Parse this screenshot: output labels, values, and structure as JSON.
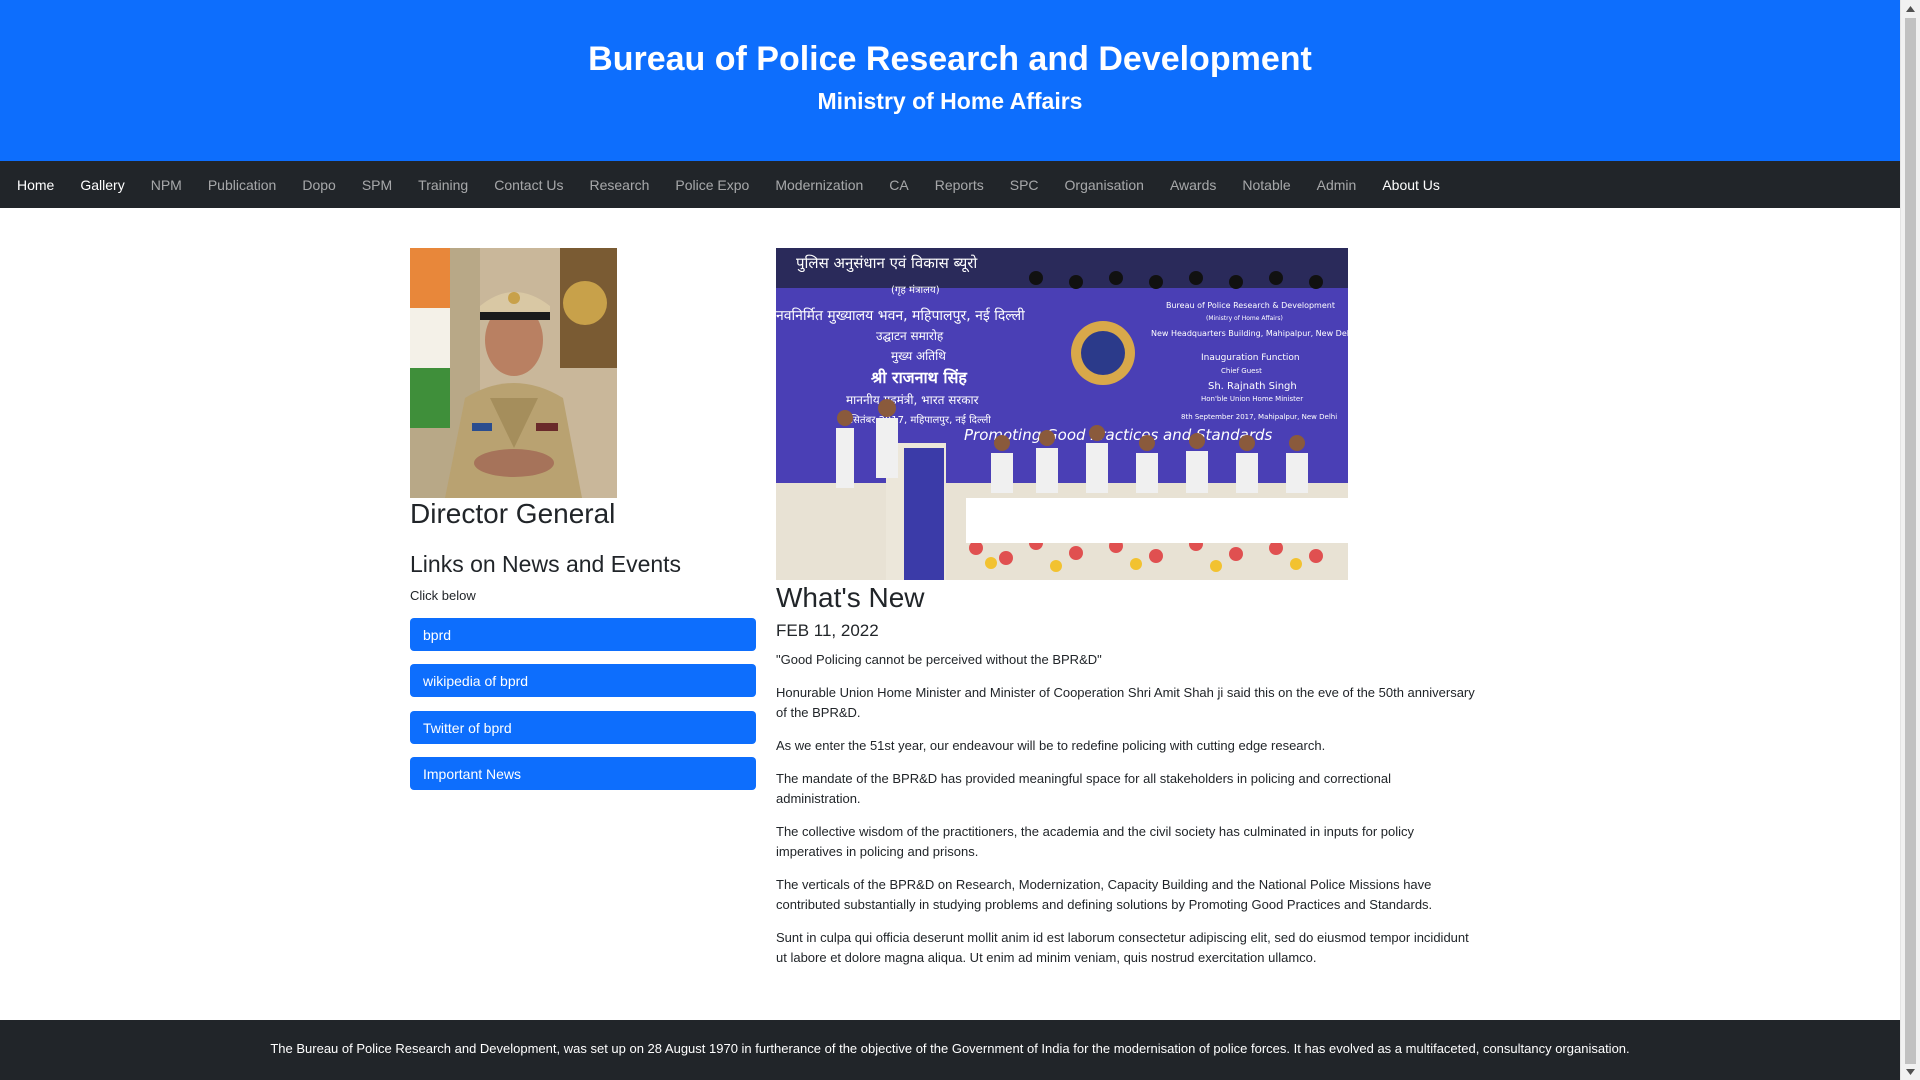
{
  "header": {
    "title": "Bureau of Police Research and Development",
    "subtitle": "Ministry of Home Affairs"
  },
  "nav": {
    "items": [
      {
        "label": "Home",
        "active": true
      },
      {
        "label": "Gallery",
        "active": true
      },
      {
        "label": "NPM"
      },
      {
        "label": "Publication"
      },
      {
        "label": "Dopo"
      },
      {
        "label": "SPM"
      },
      {
        "label": "Training"
      },
      {
        "label": "Contact Us"
      },
      {
        "label": "Research"
      },
      {
        "label": "Police Expo"
      },
      {
        "label": "Modernization"
      },
      {
        "label": "CA"
      },
      {
        "label": "Reports"
      },
      {
        "label": "SPC"
      },
      {
        "label": "Organisation"
      },
      {
        "label": "Awards"
      },
      {
        "label": "Notable"
      },
      {
        "label": "Admin"
      },
      {
        "label": "About Us",
        "active": true
      }
    ]
  },
  "left": {
    "dg_title": "Director General",
    "links_title": "Links on News and Events",
    "links_subtitle": "Click below",
    "links": [
      "bprd",
      "wikipedia of bprd",
      "Twitter of bprd",
      "Important News"
    ]
  },
  "event_banner": {
    "hindi_lines": [
      "पुलिस अनुसंधान एवं विकास ब्यूरो",
      "(गृह मंत्रालय)",
      "नवनिर्मित मुख्यालय भवन, महिपालपुर, नई दिल्ली",
      "उद्घाटन समारोह",
      "मुख्य अतिथि",
      "श्री राजनाथ सिंह",
      "माननीय गृहमंत्री, भारत सरकार",
      "8 सितंबर 2017, महिपालपुर, नई दिल्ली"
    ],
    "english_lines": [
      "Bureau of Police Research & Development",
      "(Ministry of Home Affairs)",
      "New Headquarters Building, Mahipalpur, New Delhi",
      "Inauguration Function",
      "Chief Guest",
      "Sh. Rajnath Singh",
      "Hon'ble Union Home Minister",
      "8th September 2017, Mahipalpur, New Delhi"
    ],
    "tagline": "Promoting Good Practices and Standards"
  },
  "main": {
    "whats_new_title": "What's New",
    "date": "FEB 11, 2022",
    "paragraphs": [
      "\"Good Policing cannot be perceived without the BPR&D\"",
      "Honurable Union Home Minister and Minister of Cooperation Shri Amit Shah ji said this on the eve of the 50th anniversary of the BPR&D.",
      "As we enter the 51st year, our endeavour will be to redefine policing with cutting edge research.",
      "The mandate of the BPR&D has provided meaningful space for all stakeholders in policing and correctional administration.",
      "The collective wisdom of the practitioners, the academia and the civil society has culminated in inputs for policy imperatives in policing and prisons.",
      "The verticals of the BPR&D on Research, Modernization, Capacity Building and the National Police Missions have contributed substantially in studying problems and defining solutions by Promoting Good Practices and Standards.",
      "Sunt in culpa qui officia deserunt mollit anim id est laborum consectetur adipiscing elit, sed do eiusmod tempor incididunt ut labore et dolore magna aliqua. Ut enim ad minim veniam, quis nostrud exercitation ullamco."
    ]
  },
  "footer": {
    "text": "The Bureau of Police Research and Development, was set up on 28 August 1970 in furtherance of the objective of the Government of India for the modernisation of police forces. It has evolved as a multifaceted, consultancy organisation."
  },
  "colors": {
    "primary": "#0d6efd",
    "dark": "#212529"
  }
}
